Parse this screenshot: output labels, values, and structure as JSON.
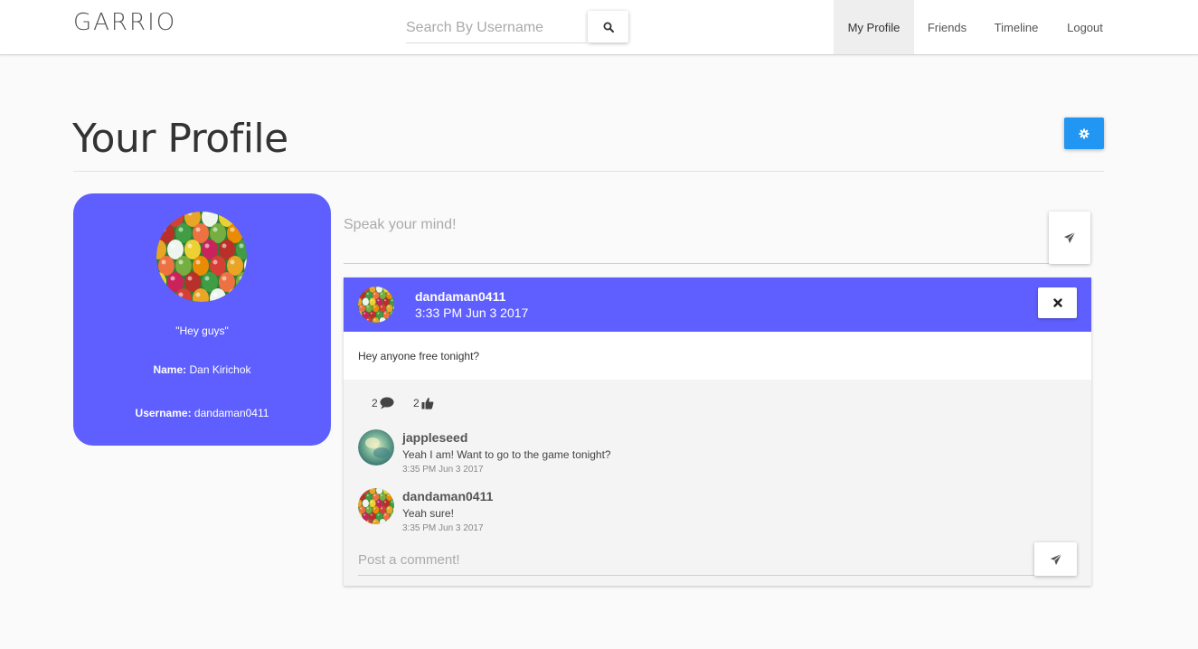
{
  "navbar": {
    "brand": "GARRIO",
    "search_placeholder": "Search By Username",
    "search_icon": "search-icon",
    "items": [
      {
        "label": "My Profile",
        "active": true
      },
      {
        "label": "Friends",
        "active": false
      },
      {
        "label": "Timeline",
        "active": false
      },
      {
        "label": "Logout",
        "active": false
      }
    ]
  },
  "header": {
    "title": "Your Profile",
    "settings_icon": "gear-icon",
    "settings_color": "#2196f3"
  },
  "profile": {
    "quote": "\"Hey guys\"",
    "name_label": "Name:",
    "name": "Dan Kirichok",
    "username_label": "Username:",
    "username": "dandaman0411",
    "card_color": "#5f5fff"
  },
  "status": {
    "placeholder": "Speak your mind!",
    "send_icon": "paper-plane-icon"
  },
  "post": {
    "author": "dandaman0411",
    "time": "3:33 PM Jun 3 2017",
    "delete_icon": "close-icon",
    "text": "Hey anyone free tonight?",
    "comment_count": "2",
    "comment_icon": "speech-bubble-icon",
    "like_count": "2",
    "like_icon": "thumbs-up-icon",
    "comments": [
      {
        "author": "jappleseed",
        "text": "Yeah I am! Want to go to the game tonight?",
        "time": "3:35 PM Jun 3 2017"
      },
      {
        "author": "dandaman0411",
        "text": "Yeah sure!",
        "time": "3:35 PM Jun 3 2017"
      }
    ],
    "comment_placeholder": "Post a comment!",
    "comment_send_icon": "paper-plane-icon"
  }
}
